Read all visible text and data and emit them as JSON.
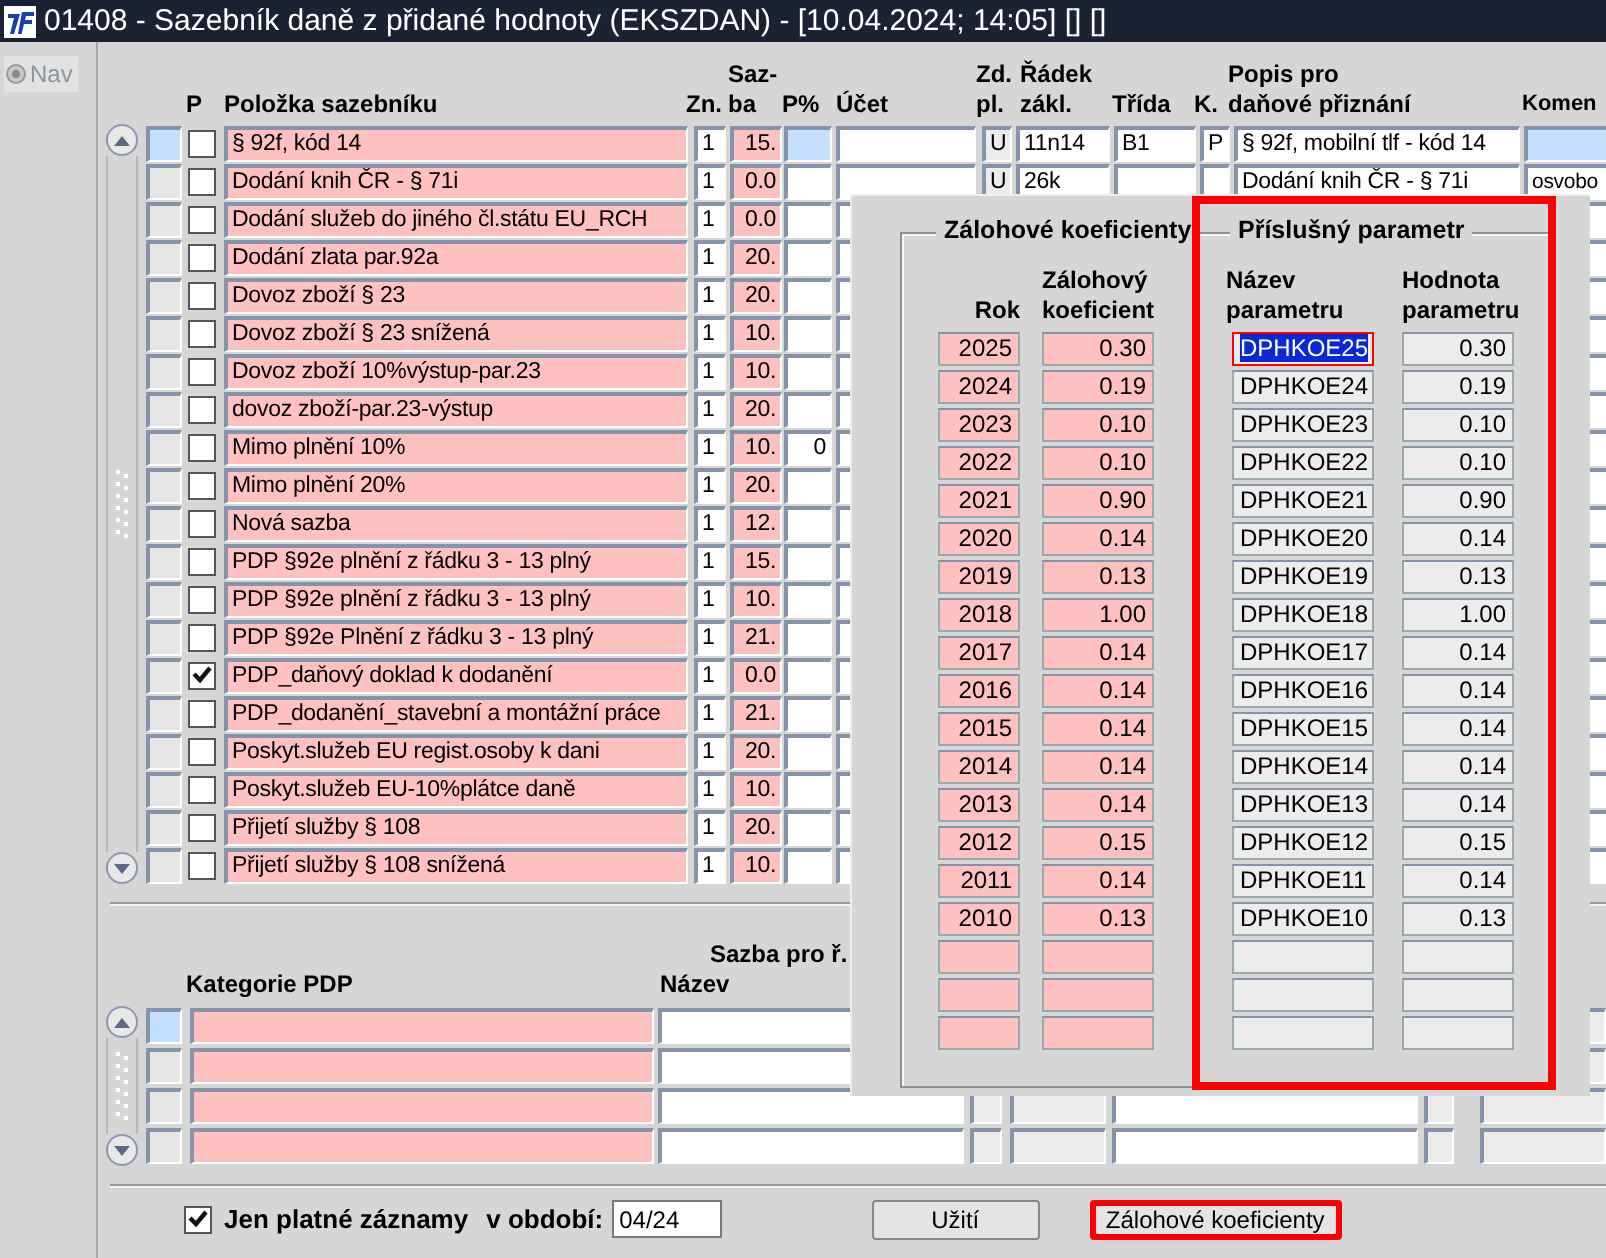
{
  "window": {
    "title": "01408 - Sazebník daně z přidané hodnoty (EKSZDAN) - [10.04.2024; 14:05] [] []"
  },
  "nav": {
    "label": "Nav",
    "disabled": true
  },
  "main_table": {
    "columns": [
      "P",
      "Položka sazebníku",
      "Zn.",
      "Saz-\nba",
      "P%",
      "Účet",
      "Zd.\npl.",
      "Řádek\nzákl.",
      "Třída",
      "K.",
      "Popis pro\ndaňové přiznání",
      "Komen"
    ],
    "rows": [
      {
        "current": true,
        "p": false,
        "polozka": "§ 92f, kód 14",
        "zn": "1",
        "sazba": "15.",
        "zd_pl": "U",
        "radek": "11n14",
        "trida": "B1",
        "k": "P",
        "popis": "§ 92f, mobilní tlf - kód 14"
      },
      {
        "current": false,
        "p": false,
        "polozka": "Dodání knih ČR - § 71i",
        "zn": "1",
        "sazba": "0.0",
        "zd_pl": "U",
        "radek": "26k",
        "popis": "Dodání knih ČR - § 71i",
        "komentar": "osvobo"
      },
      {
        "current": false,
        "p": false,
        "polozka": "Dodání služeb do jiného čl.státu EU_RCH",
        "zn": "1",
        "sazba": "0.0"
      },
      {
        "current": false,
        "p": false,
        "polozka": "Dodání zlata par.92a",
        "zn": "1",
        "sazba": "20."
      },
      {
        "current": false,
        "p": false,
        "polozka": "Dovoz zboží § 23",
        "zn": "1",
        "sazba": "20."
      },
      {
        "current": false,
        "p": false,
        "polozka": "Dovoz zboží § 23 snížená",
        "zn": "1",
        "sazba": "10."
      },
      {
        "current": false,
        "p": false,
        "polozka": "Dovoz zboží 10%výstup-par.23",
        "zn": "1",
        "sazba": "10."
      },
      {
        "current": false,
        "p": false,
        "polozka": "dovoz zboží-par.23-výstup",
        "zn": "1",
        "sazba": "20."
      },
      {
        "current": false,
        "p": false,
        "polozka": "Mimo plnění 10%",
        "zn": "1",
        "sazba": "10.",
        "procento": "0"
      },
      {
        "current": false,
        "p": false,
        "polozka": "Mimo plnění 20%",
        "zn": "1",
        "sazba": "20."
      },
      {
        "current": false,
        "p": false,
        "polozka": "Nová sazba",
        "zn": "1",
        "sazba": "12."
      },
      {
        "current": false,
        "p": false,
        "polozka": "PDP §92e plnění z řádku 3 - 13 plný",
        "zn": "1",
        "sazba": "15."
      },
      {
        "current": false,
        "p": false,
        "polozka": "PDP §92e plnění z řádku 3 - 13 plný",
        "zn": "1",
        "sazba": "10."
      },
      {
        "current": false,
        "p": false,
        "polozka": "PDP §92e Plnění z řádku 3 - 13 plný",
        "zn": "1",
        "sazba": "21."
      },
      {
        "current": false,
        "p": true,
        "polozka": "PDP_daňový doklad k dodanění",
        "zn": "1",
        "sazba": "0.0"
      },
      {
        "current": false,
        "p": false,
        "polozka": "PDP_dodanění_stavební a montážní práce",
        "zn": "1",
        "sazba": "21."
      },
      {
        "current": false,
        "p": false,
        "polozka": "Poskyt.služeb EU regist.osoby k dani",
        "zn": "1",
        "sazba": "20."
      },
      {
        "current": false,
        "p": false,
        "polozka": "Poskyt.služeb EU-10%plátce daně",
        "zn": "1",
        "sazba": "10."
      },
      {
        "current": false,
        "p": false,
        "polozka": "Přijetí služby § 108",
        "zn": "1",
        "sazba": "20."
      },
      {
        "current": false,
        "p": false,
        "polozka": "Přijetí služby § 108 snížená",
        "zn": "1",
        "sazba": "10."
      }
    ]
  },
  "pdp_table": {
    "group_header": "Sazba pro ř.",
    "columns": [
      "Kategorie PDP",
      "Název"
    ],
    "rows": [
      {
        "current": true
      },
      {
        "current": false
      },
      {
        "current": false
      },
      {
        "current": false
      }
    ]
  },
  "footer": {
    "only_valid": {
      "label": "Jen platné záznamy",
      "checked": true
    },
    "period": {
      "label": "v období:",
      "value": "04/24"
    },
    "buttons": [
      {
        "label": "Užití",
        "highlighted": false
      },
      {
        "label": "Zálohové koeficienty",
        "highlighted": true
      }
    ]
  },
  "dialog": {
    "groups": [
      {
        "title": "Zálohové koeficienty",
        "highlighted": false
      },
      {
        "title": "Příslušný parametr",
        "highlighted": true
      }
    ],
    "columns": [
      "Rok",
      "Zálohový\nkoeficient",
      "Název\nparametru",
      "Hodnota\nparametru"
    ],
    "rows": [
      {
        "rok": "2025",
        "koeficient": "0.30",
        "nazev": "DPHKOE25",
        "hodnota": "0.30",
        "selected": true
      },
      {
        "rok": "2024",
        "koeficient": "0.19",
        "nazev": "DPHKOE24",
        "hodnota": "0.19",
        "selected": false
      },
      {
        "rok": "2023",
        "koeficient": "0.10",
        "nazev": "DPHKOE23",
        "hodnota": "0.10",
        "selected": false
      },
      {
        "rok": "2022",
        "koeficient": "0.10",
        "nazev": "DPHKOE22",
        "hodnota": "0.10",
        "selected": false
      },
      {
        "rok": "2021",
        "koeficient": "0.90",
        "nazev": "DPHKOE21",
        "hodnota": "0.90",
        "selected": false
      },
      {
        "rok": "2020",
        "koeficient": "0.14",
        "nazev": "DPHKOE20",
        "hodnota": "0.14",
        "selected": false
      },
      {
        "rok": "2019",
        "koeficient": "0.13",
        "nazev": "DPHKOE19",
        "hodnota": "0.13",
        "selected": false
      },
      {
        "rok": "2018",
        "koeficient": "1.00",
        "nazev": "DPHKOE18",
        "hodnota": "1.00",
        "selected": false
      },
      {
        "rok": "2017",
        "koeficient": "0.14",
        "nazev": "DPHKOE17",
        "hodnota": "0.14",
        "selected": false
      },
      {
        "rok": "2016",
        "koeficient": "0.14",
        "nazev": "DPHKOE16",
        "hodnota": "0.14",
        "selected": false
      },
      {
        "rok": "2015",
        "koeficient": "0.14",
        "nazev": "DPHKOE15",
        "hodnota": "0.14",
        "selected": false
      },
      {
        "rok": "2014",
        "koeficient": "0.14",
        "nazev": "DPHKOE14",
        "hodnota": "0.14",
        "selected": false
      },
      {
        "rok": "2013",
        "koeficient": "0.14",
        "nazev": "DPHKOE13",
        "hodnota": "0.14",
        "selected": false
      },
      {
        "rok": "2012",
        "koeficient": "0.15",
        "nazev": "DPHKOE12",
        "hodnota": "0.15",
        "selected": false
      },
      {
        "rok": "2011",
        "koeficient": "0.14",
        "nazev": "DPHKOE11",
        "hodnota": "0.14",
        "selected": false
      },
      {
        "rok": "2010",
        "koeficient": "0.13",
        "nazev": "DPHKOE10",
        "hodnota": "0.13",
        "selected": false
      }
    ]
  }
}
